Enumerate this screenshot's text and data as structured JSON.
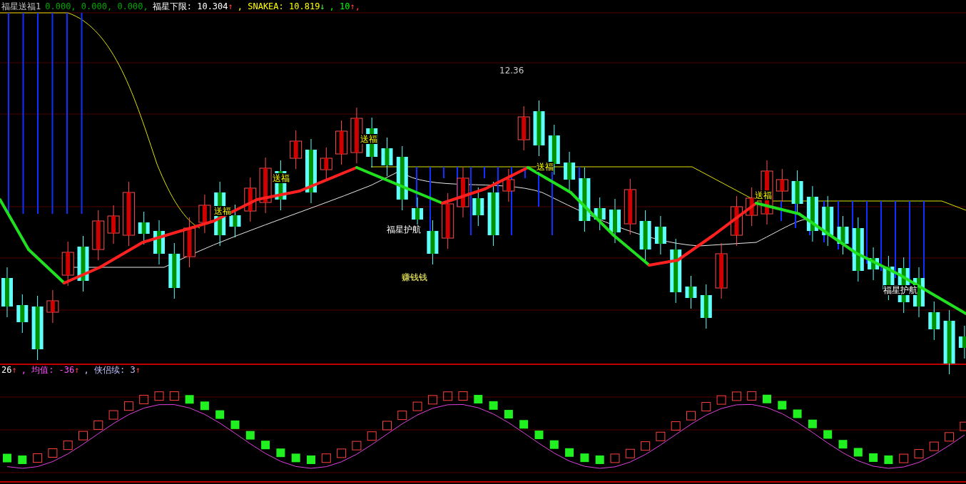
{
  "main_pane": {
    "legend": [
      {
        "kind": "text",
        "text": "福星送福1",
        "color": "#c8c8c8"
      },
      {
        "kind": "text",
        "text": "0.000, 0.000, 0.000,",
        "color": "#00a800"
      },
      {
        "kind": "text",
        "text": "福星下限: 10.304",
        "color": "#ffffff"
      },
      {
        "kind": "up",
        "text": "↑"
      },
      {
        "kind": "text",
        "text": ", SNAKEA: 10.819",
        "color": "#ffff00"
      },
      {
        "kind": "down",
        "text": "↓"
      },
      {
        "kind": "text",
        "text": ", 10",
        "color": "#00ff00"
      },
      {
        "kind": "up",
        "text": "↑,"
      }
    ],
    "signals": [
      {
        "text": "送福",
        "kind": "buy"
      },
      {
        "text": "送福",
        "kind": "buy"
      },
      {
        "text": "送福",
        "kind": "buy"
      },
      {
        "text": "送福",
        "kind": "buy"
      },
      {
        "text": "送福",
        "kind": "buy"
      },
      {
        "text": "福星护航",
        "kind": "guard"
      },
      {
        "text": "赚钱钱",
        "kind": "profit"
      },
      {
        "text": "福星护航",
        "kind": "guard"
      },
      {
        "text": "12.36",
        "kind": "peak"
      }
    ]
  },
  "lower_pane": {
    "legend": [
      {
        "kind": "text",
        "text": "26",
        "color": "#ffffff"
      },
      {
        "kind": "up",
        "text": "↑"
      },
      {
        "kind": "text",
        "text": ", 均值: -36",
        "color": "#ff50ff"
      },
      {
        "kind": "up",
        "text": "↑"
      },
      {
        "kind": "text",
        "text": ", 侠侣续: 3",
        "color": "#c0c0ff"
      },
      {
        "kind": "up",
        "text": "↑"
      }
    ]
  }
}
